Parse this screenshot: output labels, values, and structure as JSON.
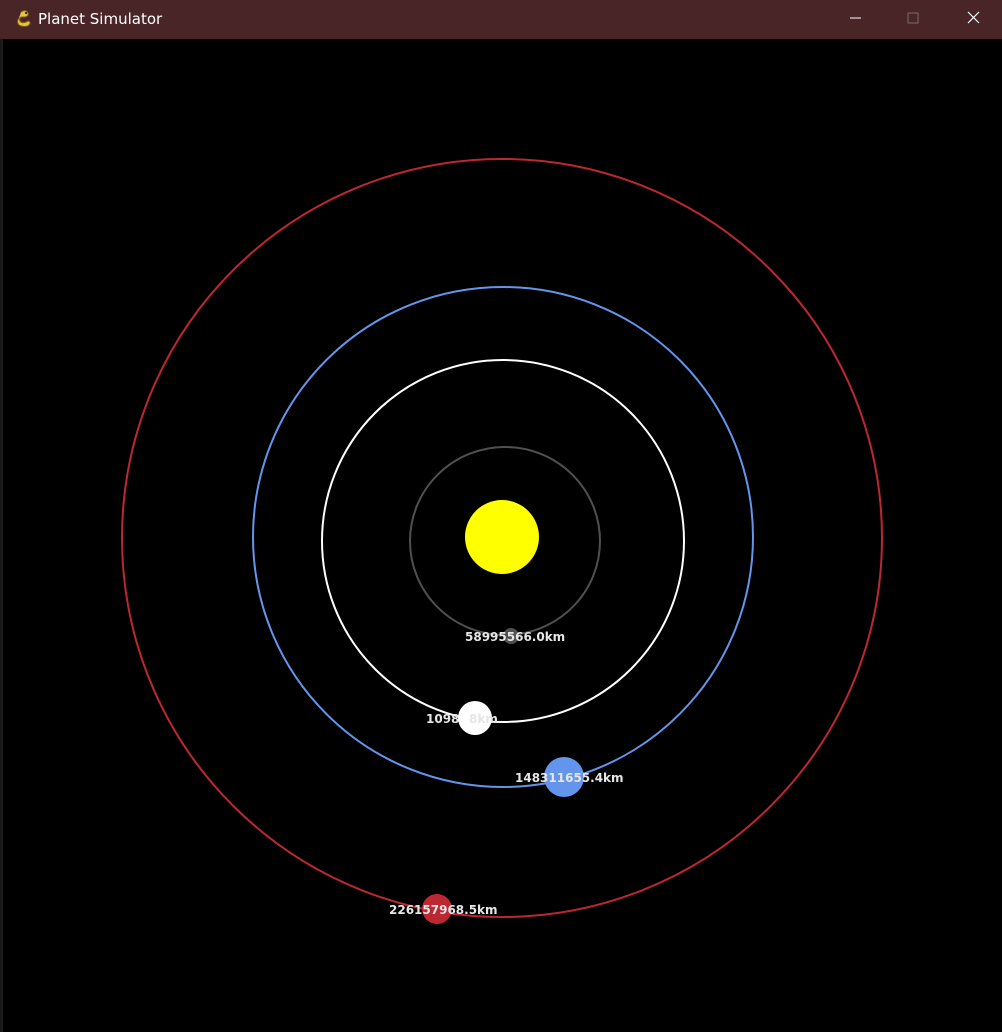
{
  "window": {
    "title": "Planet Simulator",
    "icons": {
      "app": "pygame-snake-icon",
      "minimize": "minimize-icon",
      "maximize": "maximize-icon",
      "close": "close-icon"
    }
  },
  "simulation": {
    "background_color": "#000000",
    "sun": {
      "color": "#ffff00"
    },
    "planets": [
      {
        "name_id": "mercury",
        "color": "#505050",
        "orbit_color": "#505050",
        "distance_label": "58995566.0km"
      },
      {
        "name_id": "venus",
        "color": "#ffffff",
        "orbit_color": "#ffffff",
        "distance_label": "1098    8km"
      },
      {
        "name_id": "earth",
        "color": "#6495ed",
        "orbit_color": "#6495ed",
        "distance_label": "148311655.4km"
      },
      {
        "name_id": "mars",
        "color": "#bc2732",
        "orbit_color": "#bc2732",
        "distance_label": "226157968.5km"
      }
    ]
  }
}
